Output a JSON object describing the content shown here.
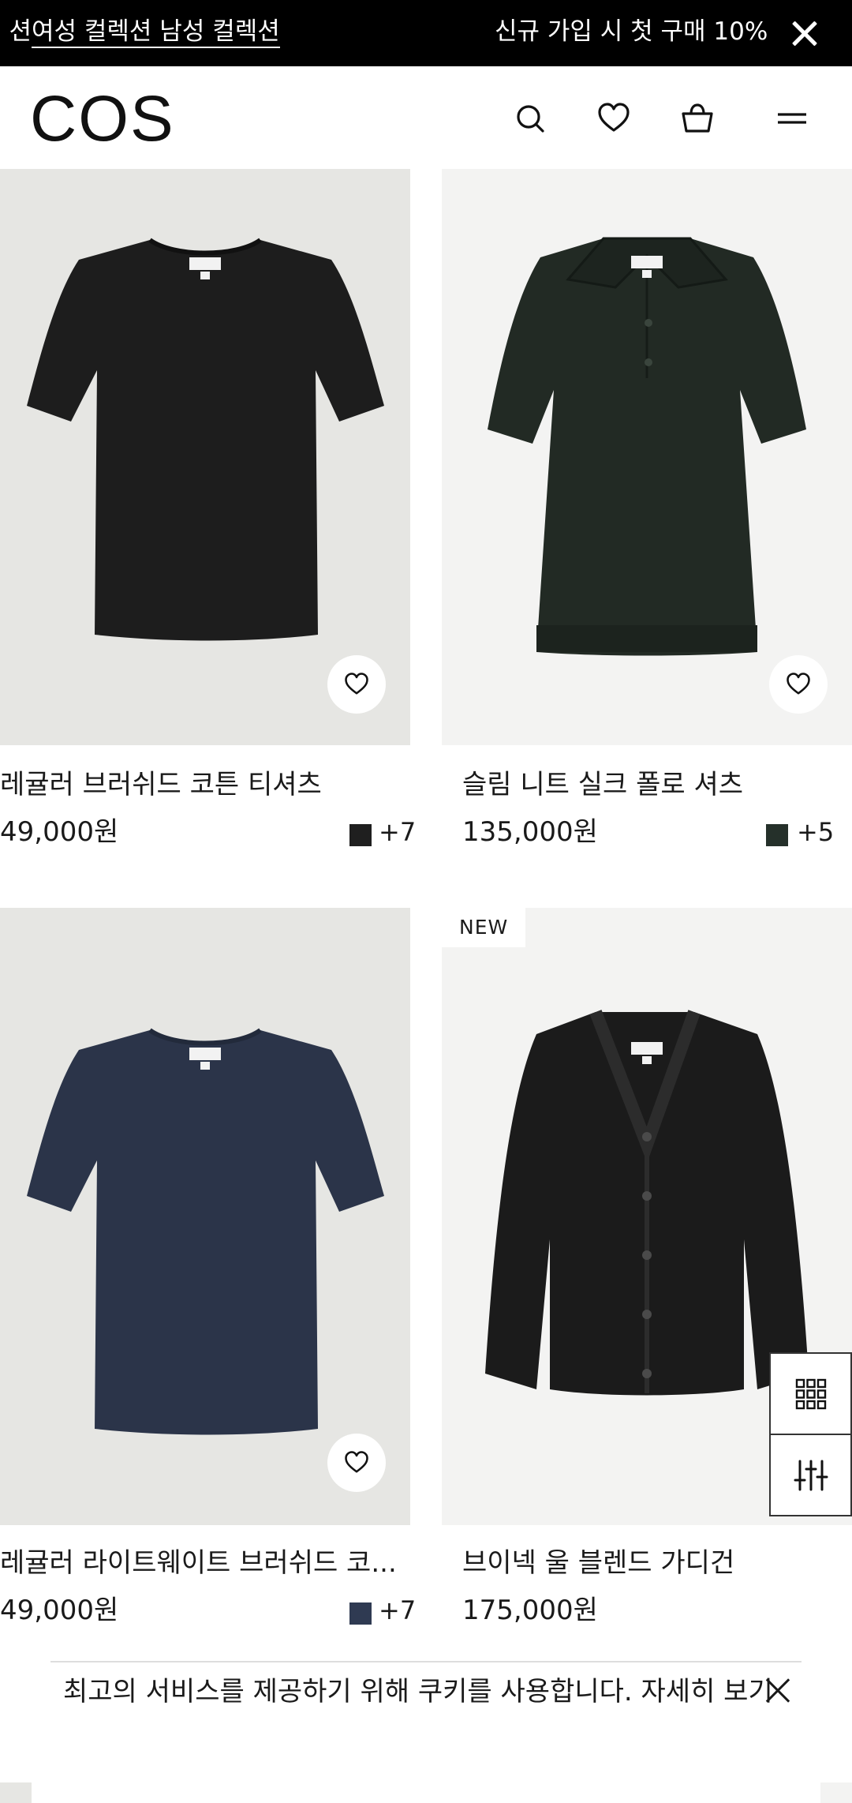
{
  "promo": {
    "left_cut": "션 | ",
    "links": "여성 컬렉션 남성 컬렉션",
    "signup_text": "신규 가입 시 첫 구매 10%"
  },
  "header": {
    "logo": "COS",
    "icons": [
      "search-icon",
      "heart-icon",
      "bag-icon",
      "menu-icon"
    ]
  },
  "products": [
    {
      "name": "레귤러 브러쉬드 코튼 티셔츠",
      "price": "49,000원",
      "swatch_color": "#1f1f1f",
      "more_colors": "+7",
      "image_bg": "#e6e6e3",
      "garment_color": "#1d1d1d"
    },
    {
      "name": "슬림 니트 실크 폴로 셔츠",
      "price": "135,000원",
      "swatch_color": "#25302a",
      "more_colors": "+5",
      "image_bg": "#f3f3f2",
      "garment_color": "#222a24"
    },
    {
      "name": "레귤러 라이트웨이트 브러쉬드 코...",
      "price": "49,000원",
      "swatch_color": "#2f3a52",
      "more_colors": "+7",
      "image_bg": "#e6e6e3",
      "garment_color": "#2b3449"
    },
    {
      "name": "브이넥 울 블렌드 가디건",
      "price": "175,000원",
      "badge": "NEW",
      "image_bg": "#f3f3f2",
      "garment_color": "#1b1b1b"
    }
  ],
  "cookie": {
    "message": "최고의 서비스를 제공하기 위해 쿠키를 사용합니다. 자세히 보기"
  }
}
